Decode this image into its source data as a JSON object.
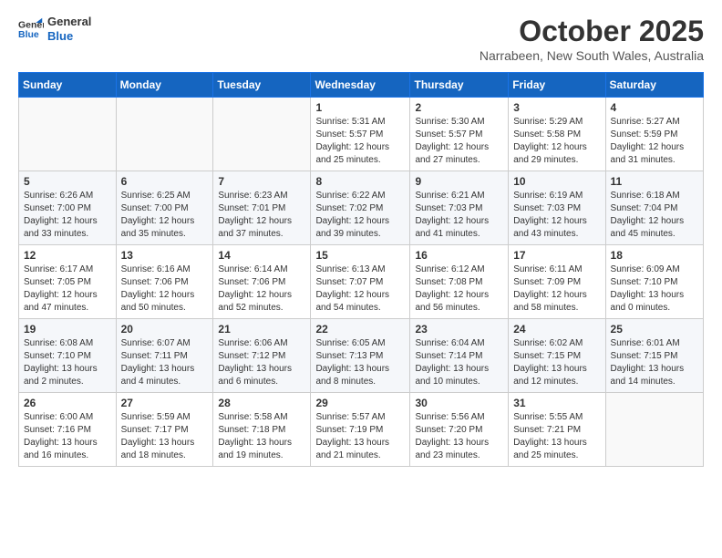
{
  "header": {
    "logo_line1": "General",
    "logo_line2": "Blue",
    "month": "October 2025",
    "location": "Narrabeen, New South Wales, Australia"
  },
  "days_of_week": [
    "Sunday",
    "Monday",
    "Tuesday",
    "Wednesday",
    "Thursday",
    "Friday",
    "Saturday"
  ],
  "weeks": [
    [
      {
        "day": "",
        "info": ""
      },
      {
        "day": "",
        "info": ""
      },
      {
        "day": "",
        "info": ""
      },
      {
        "day": "1",
        "info": "Sunrise: 5:31 AM\nSunset: 5:57 PM\nDaylight: 12 hours\nand 25 minutes."
      },
      {
        "day": "2",
        "info": "Sunrise: 5:30 AM\nSunset: 5:57 PM\nDaylight: 12 hours\nand 27 minutes."
      },
      {
        "day": "3",
        "info": "Sunrise: 5:29 AM\nSunset: 5:58 PM\nDaylight: 12 hours\nand 29 minutes."
      },
      {
        "day": "4",
        "info": "Sunrise: 5:27 AM\nSunset: 5:59 PM\nDaylight: 12 hours\nand 31 minutes."
      }
    ],
    [
      {
        "day": "5",
        "info": "Sunrise: 6:26 AM\nSunset: 7:00 PM\nDaylight: 12 hours\nand 33 minutes."
      },
      {
        "day": "6",
        "info": "Sunrise: 6:25 AM\nSunset: 7:00 PM\nDaylight: 12 hours\nand 35 minutes."
      },
      {
        "day": "7",
        "info": "Sunrise: 6:23 AM\nSunset: 7:01 PM\nDaylight: 12 hours\nand 37 minutes."
      },
      {
        "day": "8",
        "info": "Sunrise: 6:22 AM\nSunset: 7:02 PM\nDaylight: 12 hours\nand 39 minutes."
      },
      {
        "day": "9",
        "info": "Sunrise: 6:21 AM\nSunset: 7:03 PM\nDaylight: 12 hours\nand 41 minutes."
      },
      {
        "day": "10",
        "info": "Sunrise: 6:19 AM\nSunset: 7:03 PM\nDaylight: 12 hours\nand 43 minutes."
      },
      {
        "day": "11",
        "info": "Sunrise: 6:18 AM\nSunset: 7:04 PM\nDaylight: 12 hours\nand 45 minutes."
      }
    ],
    [
      {
        "day": "12",
        "info": "Sunrise: 6:17 AM\nSunset: 7:05 PM\nDaylight: 12 hours\nand 47 minutes."
      },
      {
        "day": "13",
        "info": "Sunrise: 6:16 AM\nSunset: 7:06 PM\nDaylight: 12 hours\nand 50 minutes."
      },
      {
        "day": "14",
        "info": "Sunrise: 6:14 AM\nSunset: 7:06 PM\nDaylight: 12 hours\nand 52 minutes."
      },
      {
        "day": "15",
        "info": "Sunrise: 6:13 AM\nSunset: 7:07 PM\nDaylight: 12 hours\nand 54 minutes."
      },
      {
        "day": "16",
        "info": "Sunrise: 6:12 AM\nSunset: 7:08 PM\nDaylight: 12 hours\nand 56 minutes."
      },
      {
        "day": "17",
        "info": "Sunrise: 6:11 AM\nSunset: 7:09 PM\nDaylight: 12 hours\nand 58 minutes."
      },
      {
        "day": "18",
        "info": "Sunrise: 6:09 AM\nSunset: 7:10 PM\nDaylight: 13 hours\nand 0 minutes."
      }
    ],
    [
      {
        "day": "19",
        "info": "Sunrise: 6:08 AM\nSunset: 7:10 PM\nDaylight: 13 hours\nand 2 minutes."
      },
      {
        "day": "20",
        "info": "Sunrise: 6:07 AM\nSunset: 7:11 PM\nDaylight: 13 hours\nand 4 minutes."
      },
      {
        "day": "21",
        "info": "Sunrise: 6:06 AM\nSunset: 7:12 PM\nDaylight: 13 hours\nand 6 minutes."
      },
      {
        "day": "22",
        "info": "Sunrise: 6:05 AM\nSunset: 7:13 PM\nDaylight: 13 hours\nand 8 minutes."
      },
      {
        "day": "23",
        "info": "Sunrise: 6:04 AM\nSunset: 7:14 PM\nDaylight: 13 hours\nand 10 minutes."
      },
      {
        "day": "24",
        "info": "Sunrise: 6:02 AM\nSunset: 7:15 PM\nDaylight: 13 hours\nand 12 minutes."
      },
      {
        "day": "25",
        "info": "Sunrise: 6:01 AM\nSunset: 7:15 PM\nDaylight: 13 hours\nand 14 minutes."
      }
    ],
    [
      {
        "day": "26",
        "info": "Sunrise: 6:00 AM\nSunset: 7:16 PM\nDaylight: 13 hours\nand 16 minutes."
      },
      {
        "day": "27",
        "info": "Sunrise: 5:59 AM\nSunset: 7:17 PM\nDaylight: 13 hours\nand 18 minutes."
      },
      {
        "day": "28",
        "info": "Sunrise: 5:58 AM\nSunset: 7:18 PM\nDaylight: 13 hours\nand 19 minutes."
      },
      {
        "day": "29",
        "info": "Sunrise: 5:57 AM\nSunset: 7:19 PM\nDaylight: 13 hours\nand 21 minutes."
      },
      {
        "day": "30",
        "info": "Sunrise: 5:56 AM\nSunset: 7:20 PM\nDaylight: 13 hours\nand 23 minutes."
      },
      {
        "day": "31",
        "info": "Sunrise: 5:55 AM\nSunset: 7:21 PM\nDaylight: 13 hours\nand 25 minutes."
      },
      {
        "day": "",
        "info": ""
      }
    ]
  ]
}
